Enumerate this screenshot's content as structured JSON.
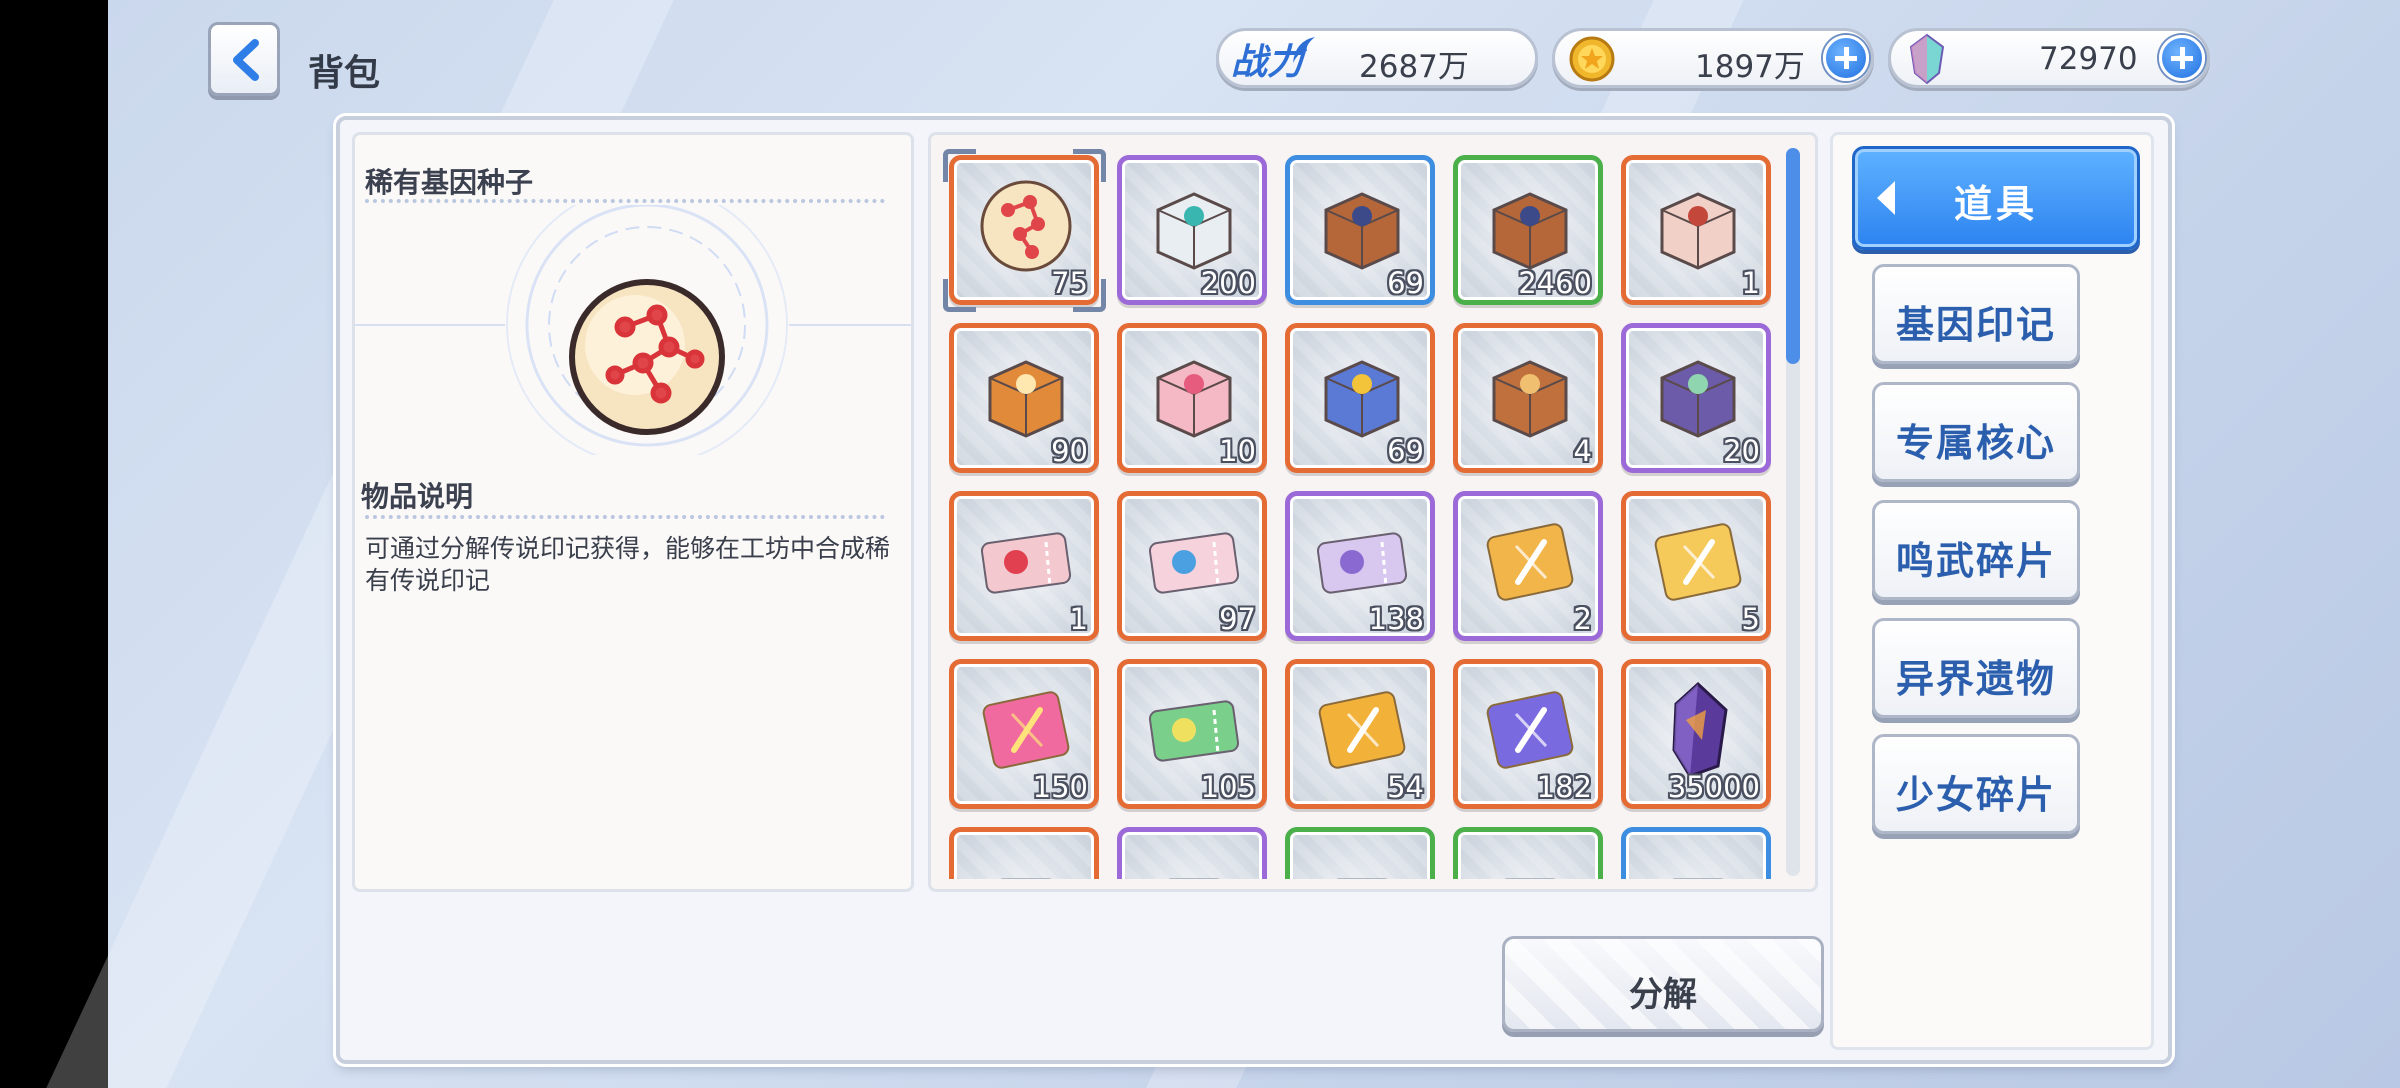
{
  "header": {
    "title": "背包",
    "power_label": "战力",
    "power_value": "2687万",
    "gold_value": "1897万",
    "gem_value": "72970"
  },
  "detail": {
    "item_name": "稀有基因种子",
    "desc_heading": "物品说明",
    "desc_text": "可通过分解传说印记获得，能够在工坊中合成稀有传说印记"
  },
  "grid": {
    "items": [
      {
        "count": "75",
        "rarity": "orange",
        "icon": "gene-seed-icon"
      },
      {
        "count": "200",
        "rarity": "purple",
        "icon": "dna-helix-icon"
      },
      {
        "count": "69",
        "rarity": "blue",
        "icon": "tech-crate-icon"
      },
      {
        "count": "2460",
        "rarity": "green",
        "icon": "tech-crate-icon"
      },
      {
        "count": "1",
        "rarity": "orange",
        "icon": "dna-box-icon"
      },
      {
        "count": "90",
        "rarity": "orange",
        "icon": "silhouette-box-icon"
      },
      {
        "count": "10",
        "rarity": "orange",
        "icon": "gift-bag-icon"
      },
      {
        "count": "69",
        "rarity": "orange",
        "icon": "star-gift-box-icon"
      },
      {
        "count": "4",
        "rarity": "orange",
        "icon": "star-chest-icon"
      },
      {
        "count": "20",
        "rarity": "purple",
        "icon": "cat-box-icon"
      },
      {
        "count": "1",
        "rarity": "orange",
        "icon": "red-ticket-icon"
      },
      {
        "count": "97",
        "rarity": "orange",
        "icon": "outfit-ticket-icon"
      },
      {
        "count": "138",
        "rarity": "purple",
        "icon": "smile-ticket-icon"
      },
      {
        "count": "2",
        "rarity": "purple",
        "icon": "gold-dna-card-icon"
      },
      {
        "count": "5",
        "rarity": "orange",
        "icon": "gold-card-icon"
      },
      {
        "count": "150",
        "rarity": "orange",
        "icon": "rainbow-dna-card-icon"
      },
      {
        "count": "105",
        "rarity": "orange",
        "icon": "rainbow-ticket-icon"
      },
      {
        "count": "54",
        "rarity": "orange",
        "icon": "gold-sword-card-icon"
      },
      {
        "count": "182",
        "rarity": "orange",
        "icon": "purple-sword-card-icon"
      },
      {
        "count": "35000",
        "rarity": "orange",
        "icon": "crystal-icon"
      },
      {
        "count": "",
        "rarity": "orange",
        "icon": "item-icon"
      },
      {
        "count": "",
        "rarity": "purple",
        "icon": "item-icon"
      },
      {
        "count": "",
        "rarity": "green",
        "icon": "item-icon"
      },
      {
        "count": "",
        "rarity": "green",
        "icon": "item-icon"
      },
      {
        "count": "",
        "rarity": "blue",
        "icon": "item-icon"
      }
    ]
  },
  "tabs": {
    "active": "道具",
    "items": [
      "基因印记",
      "专属核心",
      "鸣武碎片",
      "异界遗物",
      "少女碎片"
    ]
  },
  "actions": {
    "decompose": "分解"
  },
  "colors": {
    "orange": "#e56b35",
    "purple": "#9b6ad8",
    "blue": "#3d8de0",
    "green": "#4bb04a",
    "accent": "#2d83f0"
  }
}
